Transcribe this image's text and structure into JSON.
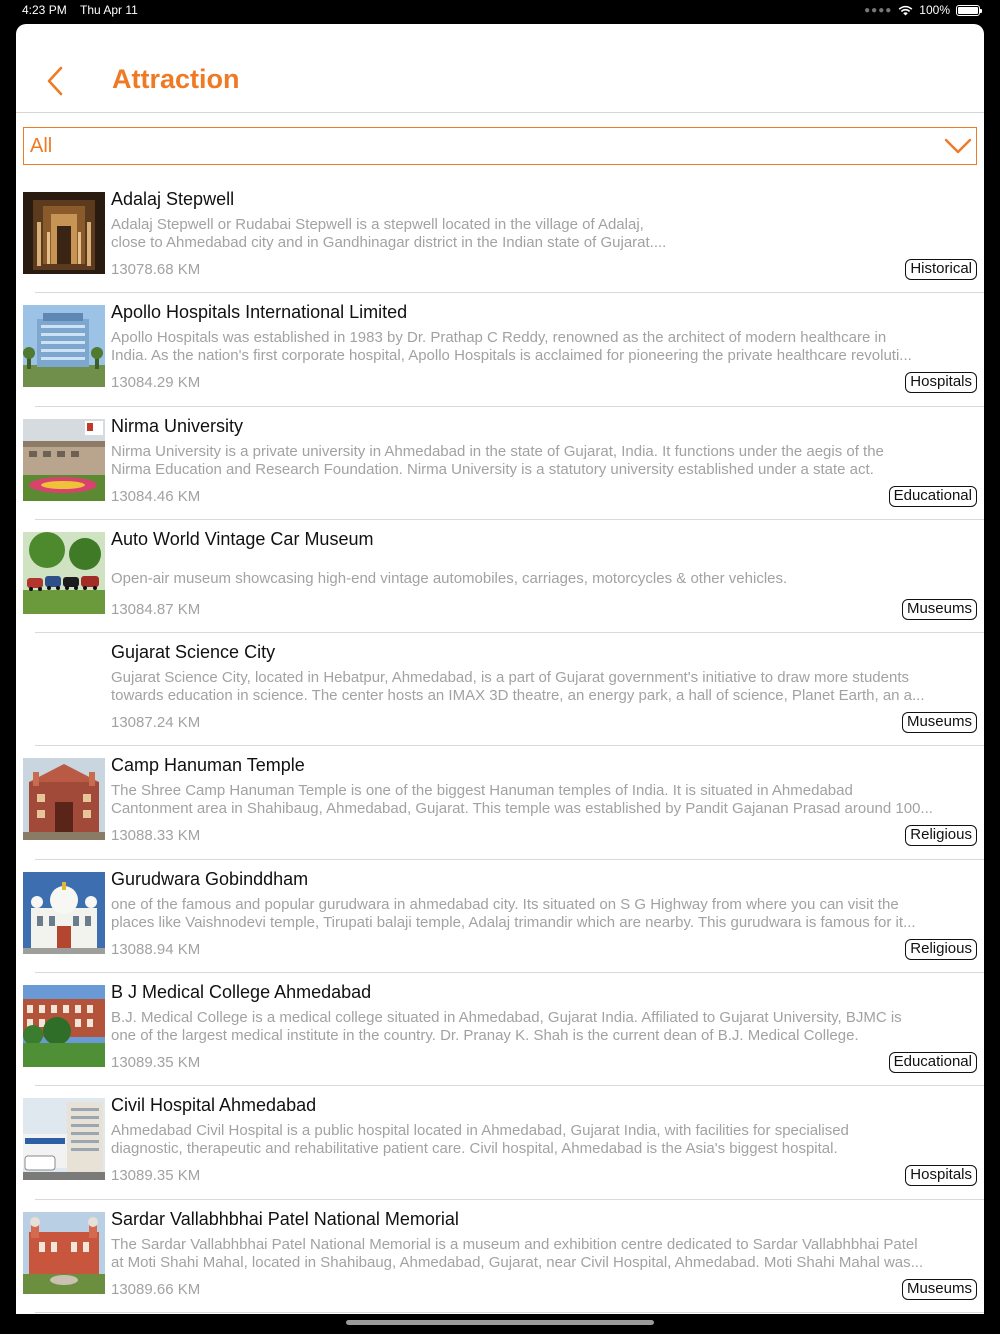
{
  "status_bar": {
    "time": "4:23 PM",
    "date": "Thu Apr 11",
    "battery": "100%"
  },
  "header": {
    "title": "Attraction",
    "back_icon": "chevron-left-icon"
  },
  "filter": {
    "selected": "All",
    "icon": "chevron-down-icon"
  },
  "colors": {
    "accent": "#ef7a26",
    "muted_text": "#a2a2a2",
    "divider": "#d9d9d9"
  },
  "attractions": [
    {
      "name": "Adalaj Stepwell",
      "description": [
        "Adalaj Stepwell or Rudabai Stepwell is a stepwell located in the village of Adalaj,",
        "close to Ahmedabad city and in Gandhinagar district in the Indian state of Gujarat...."
      ],
      "distance": "13078.68 KM",
      "category": "Historical"
    },
    {
      "name": "Apollo Hospitals International Limited",
      "description": [
        "Apollo Hospitals was established in 1983 by Dr. Prathap C Reddy, renowned as the architect of modern healthcare in",
        "India. As the nation's first corporate hospital, Apollo Hospitals is acclaimed for pioneering the private healthcare revoluti..."
      ],
      "distance": "13084.29 KM",
      "category": "Hospitals"
    },
    {
      "name": "Nirma University",
      "description": [
        "Nirma University is a private university in Ahmedabad in the state of Gujarat, India. It functions under the aegis of the",
        "Nirma Education and Research Foundation. Nirma University is a statutory university established under a state act."
      ],
      "distance": "13084.46 KM",
      "category": "Educational"
    },
    {
      "name": "Auto World Vintage Car Museum",
      "description": [
        "Open-air museum showcasing high-end vintage automobiles, carriages, motorcycles & other vehicles."
      ],
      "distance": "13084.87 KM",
      "category": "Museums"
    },
    {
      "name": "Gujarat Science City",
      "description": [
        "Gujarat Science City, located in Hebatpur, Ahmedabad, is a part of Gujarat government's initiative to draw more students",
        "towards education in science. The center hosts an IMAX 3D theatre, an energy park, a hall of science, Planet Earth, an a..."
      ],
      "distance": "13087.24 KM",
      "category": "Museums"
    },
    {
      "name": "Camp Hanuman Temple",
      "description": [
        "The Shree Camp Hanuman Temple is one of the biggest Hanuman temples of India. It is situated in Ahmedabad",
        "Cantonment area in Shahibaug, Ahmedabad, Gujarat. This temple was established by Pandit Gajanan Prasad around 100..."
      ],
      "distance": "13088.33 KM",
      "category": "Religious"
    },
    {
      "name": "Gurudwara Gobinddham",
      "description": [
        "one of the famous and popular gurudwara in ahmedabad city. Its situated on S G Highway from where you can visit the",
        "places like Vaishnodevi temple, Tirupati balaji temple, Adalaj trimandir which are nearby. This gurudwara is famous for it..."
      ],
      "distance": "13088.94 KM",
      "category": "Religious"
    },
    {
      "name": "B J Medical College Ahmedabad",
      "description": [
        "B.J. Medical College is a medical college situated in Ahmedabad, Gujarat India. Affiliated to Gujarat University, BJMC is",
        "one of the largest medical institute in the country. Dr. Pranay K. Shah is the current dean of B.J. Medical College."
      ],
      "distance": "13089.35 KM",
      "category": "Educational"
    },
    {
      "name": "Civil Hospital Ahmedabad",
      "description": [
        "Ahmedabad Civil Hospital is a public hospital located in Ahmedabad, Gujarat India, with facilities for specialised",
        "diagnostic, therapeutic and rehabilitative patient care. Civil hospital, Ahmedabad is the Asia's biggest hospital."
      ],
      "distance": "13089.35 KM",
      "category": "Hospitals"
    },
    {
      "name": "Sardar Vallabhbhai Patel National Memorial",
      "description": [
        "The Sardar Vallabhbhai Patel National Memorial is a museum and exhibition centre dedicated to Sardar Vallabhbhai Patel",
        "at Moti Shahi Mahal, located in Shahibaug, Ahmedabad, Gujarat, near Civil Hospital, Ahmedabad. Moti Shahi Mahal was..."
      ],
      "distance": "13089.66 KM",
      "category": "Museums"
    }
  ]
}
